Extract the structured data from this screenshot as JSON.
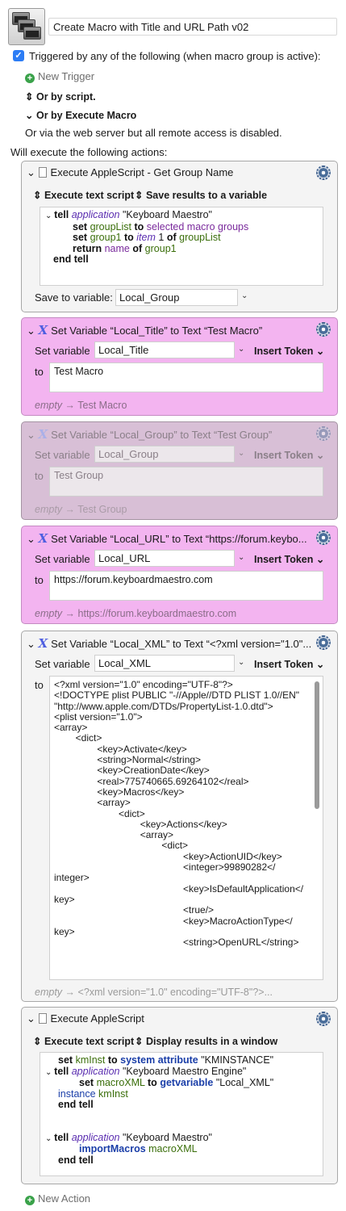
{
  "macro": {
    "title": "Create Macro with Title and URL Path v02"
  },
  "triggers": {
    "header": "Triggered by any of the following (when macro group is active):",
    "new_trigger": "New Trigger",
    "by_script": "Or by script.",
    "by_execute": "Or by Execute Macro",
    "web_server": "Or via the web server but all remote access is disabled."
  },
  "actions_header": "Will execute the following actions:",
  "actions": [
    {
      "title": "Execute AppleScript - Get Group Name",
      "opt1": "Execute text script",
      "opt2": "Save results to a variable",
      "code": [
        "tell",
        "application",
        "\"Keyboard Maestro\"",
        "set",
        "groupList",
        "to",
        "selected macro groups",
        "set",
        "group1",
        "to",
        "item",
        "1",
        "of",
        "groupList",
        "return",
        "name",
        "of",
        "group1",
        "end tell"
      ],
      "save_label": "Save to variable:",
      "save_value": "Local_Group"
    },
    {
      "title": "Set Variable “Local_Title” to Text “Test Macro”",
      "set_label": "Set variable",
      "var": "Local_Title",
      "insert": "Insert Token",
      "to_label": "to",
      "text": "Test Macro",
      "preview_empty": "empty",
      "preview": "Test Macro"
    },
    {
      "title": "Set Variable “Local_Group” to Text “Test Group”",
      "set_label": "Set variable",
      "var": "Local_Group",
      "insert": "Insert Token",
      "to_label": "to",
      "text": "Test Group",
      "preview_empty": "empty",
      "preview": "Test Group"
    },
    {
      "title": "Set Variable “Local_URL” to Text “https://forum.keybo...",
      "set_label": "Set variable",
      "var": "Local_URL",
      "insert": "Insert Token",
      "to_label": "to",
      "text": "https://forum.keyboardmaestro.com",
      "preview_empty": "empty",
      "preview": "https://forum.keyboardmaestro.com"
    },
    {
      "title": "Set Variable “Local_XML” to Text “<?xml version=\"1.0\"...",
      "set_label": "Set variable",
      "var": "Local_XML",
      "insert": "Insert Token",
      "to_label": "to",
      "xml": "<?xml version=\"1.0\" encoding=\"UTF-8\"?>\n<!DOCTYPE plist PUBLIC \"-//Apple//DTD PLIST 1.0//EN\"\n\"http://www.apple.com/DTDs/PropertyList-1.0.dtd\">\n<plist version=\"1.0\">\n<array>\n        <dict>\n                <key>Activate</key>\n                <string>Normal</string>\n                <key>CreationDate</key>\n                <real>775740665.69264102</real>\n                <key>Macros</key>\n                <array>\n                        <dict>\n                                <key>Actions</key>\n                                <array>\n                                        <dict>\n                                                <key>ActionUID</key>\n                                                <integer>99890282</\ninteger>\n                                                <key>IsDefaultApplication</\nkey>\n                                                <true/>\n                                                <key>MacroActionType</\nkey>\n                                                <string>OpenURL</string>",
      "preview_empty": "empty",
      "preview": "<?xml version=\"1.0\" encoding=\"UTF-8\"?>..."
    },
    {
      "title": "Execute AppleScript",
      "opt1": "Execute text script",
      "opt2": "Display results in a window",
      "code2": [
        "set",
        "kmInst",
        "to",
        "system attribute",
        "\"KMINSTANCE\"",
        "tell",
        "application",
        "\"Keyboard Maestro Engine\"",
        "set",
        "macroXML",
        "to",
        "getvariable",
        "\"Local_XML\"",
        "instance",
        "kmInst",
        "end tell",
        "tell",
        "application",
        "\"Keyboard Maestro\"",
        "importMacros",
        "macroXML",
        "end tell"
      ]
    }
  ],
  "new_action": "New Action",
  "icons": {
    "check": "✓",
    "plus": "+",
    "chevron": "⌄",
    "updown": "⇕",
    "arrow": "→"
  }
}
